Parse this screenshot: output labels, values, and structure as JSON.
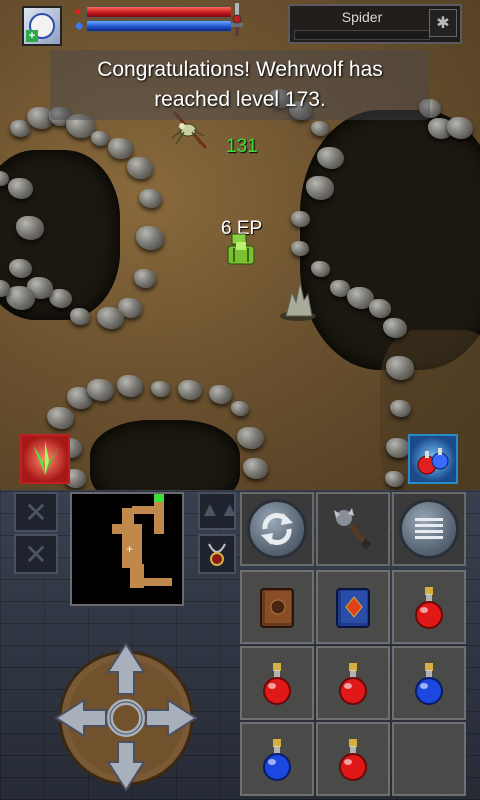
{
  "hud": {
    "hp_fraction": 1.0,
    "mp_fraction": 1.0,
    "target_name": "Spider",
    "target_hp_fraction": 0.0
  },
  "message": {
    "line1": "Congratulations! Wehrwolf has",
    "line2": "reached level 173."
  },
  "floating": {
    "damage": "131",
    "exp": "6 EP"
  },
  "icons": {
    "portrait": "wizard-portrait-icon",
    "target": "spider-icon",
    "skill_left": "nature-skill-icon",
    "skill_right": "potion-skill-icon",
    "cycle": "cycle-arrows-icon",
    "weapon": "mace-icon",
    "menu": "menu-lines-icon",
    "amulet": "amulet-icon"
  },
  "inventory": [
    {
      "name": "brown-book-icon"
    },
    {
      "name": "blue-book-icon"
    },
    {
      "name": "red-potion-icon"
    },
    {
      "name": "red-potion-icon"
    },
    {
      "name": "red-potion-icon"
    },
    {
      "name": "blue-potion-icon"
    },
    {
      "name": "blue-potion-icon"
    },
    {
      "name": "red-potion-icon"
    },
    {
      "name": "empty-slot"
    }
  ],
  "colors": {
    "hp": "#c0141a",
    "mp": "#1a4ec8",
    "damage_text": "#3ce03c",
    "exp_text": "#ffffff"
  }
}
